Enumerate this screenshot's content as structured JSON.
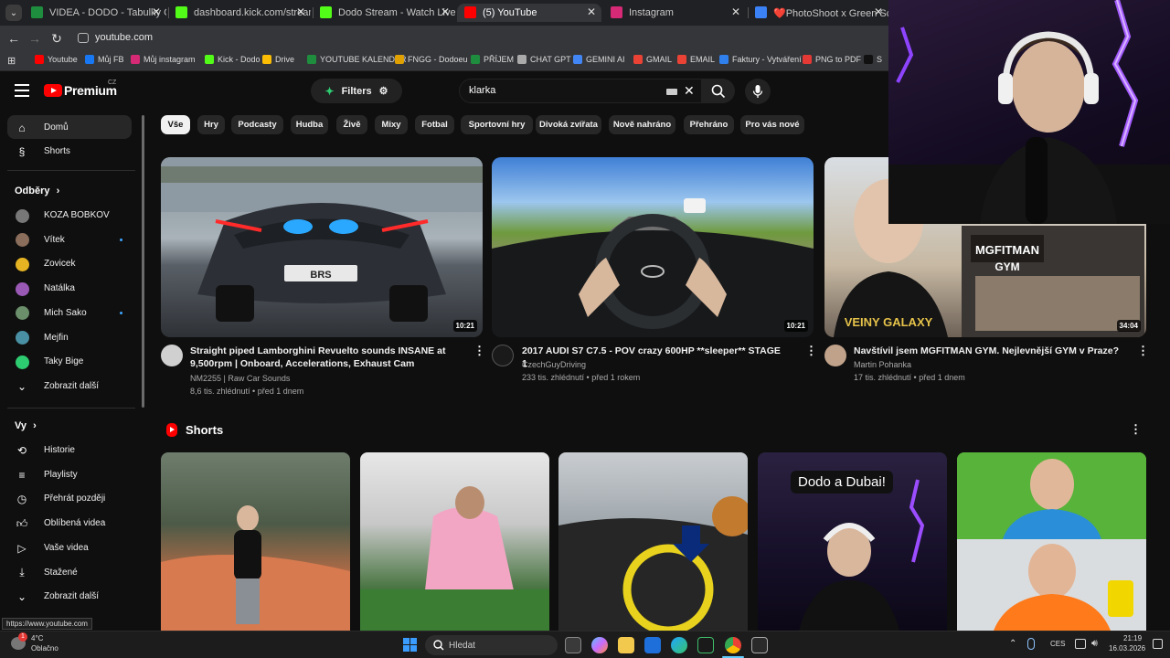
{
  "browser": {
    "tabs": [
      {
        "title": "VIDEA - DODO - Tabulky Googl",
        "favicon_color": "#1e8e3e"
      },
      {
        "title": "dashboard.kick.com/stream",
        "favicon_color": "#53fc18"
      },
      {
        "title": "Dodo Stream - Watch Live on K",
        "favicon_color": "#53fc18"
      },
      {
        "title": "(5) YouTube",
        "favicon_color": "#ff0000"
      },
      {
        "title": "Instagram",
        "favicon_color": "#d62976"
      },
      {
        "title": "❤️PhotoShoot x Green Scre",
        "favicon_color": "#3b82f6"
      }
    ],
    "active_tab_index": 3,
    "url": "youtube.com",
    "bookmarks": [
      {
        "label": "Youtube",
        "color": "#ff0000"
      },
      {
        "label": "Můj FB",
        "color": "#1877f2"
      },
      {
        "label": "Můj instagram",
        "color": "#d62976"
      },
      {
        "label": "Kick - Dodo",
        "color": "#53fc18"
      },
      {
        "label": "Drive",
        "color": "#fbbc04"
      },
      {
        "label": "YOUTUBE KALENDÁŘ",
        "color": "#1e8e3e"
      },
      {
        "label": "FNGG - Dodoeu",
        "color": "#e0a000"
      },
      {
        "label": "PŘÍJEM",
        "color": "#1e8e3e"
      },
      {
        "label": "CHAT GPT",
        "color": "#aaaaaa"
      },
      {
        "label": "GEMINI AI",
        "color": "#4285f4"
      },
      {
        "label": "GMAIL",
        "color": "#ea4335"
      },
      {
        "label": "EMAIL",
        "color": "#ea4335"
      },
      {
        "label": "Faktury - Vytváření",
        "color": "#2f80ed"
      },
      {
        "label": "PNG to PDF",
        "color": "#e53935"
      },
      {
        "label": "S",
        "color": "#111111"
      }
    ]
  },
  "youtube": {
    "brand": "Premium",
    "country": "CZ",
    "filters_label": "Filters",
    "search_value": "klarka",
    "sidebar": {
      "main": [
        {
          "label": "Domů",
          "icon": "home-icon"
        },
        {
          "label": "Shorts",
          "icon": "shorts-icon"
        }
      ],
      "subscriptions_title": "Odběry",
      "subscriptions": [
        {
          "label": "KOZA BOBKOV",
          "color": "#777777",
          "new": false
        },
        {
          "label": "Vítek",
          "color": "#8a6d5a",
          "new": true
        },
        {
          "label": "Zovicek",
          "color": "#e6b422",
          "new": false
        },
        {
          "label": "Natálka",
          "color": "#9b59b6",
          "new": false
        },
        {
          "label": "Mich Sako",
          "color": "#6b8e6b",
          "new": true
        },
        {
          "label": "Mejfin",
          "color": "#4a90a4",
          "new": false
        },
        {
          "label": "Taky Bige",
          "color": "#2ecc71",
          "new": false
        }
      ],
      "show_more": "Zobrazit další",
      "you_title": "Vy",
      "you": [
        {
          "label": "Historie",
          "icon": "history-icon"
        },
        {
          "label": "Playlisty",
          "icon": "playlist-icon"
        },
        {
          "label": "Přehrát později",
          "icon": "watch-later-icon"
        },
        {
          "label": "Oblíbená videa",
          "icon": "like-icon"
        },
        {
          "label": "Vaše videa",
          "icon": "your-videos-icon"
        },
        {
          "label": "Stažené",
          "icon": "download-icon"
        }
      ],
      "show_more_2": "Zobrazit další"
    },
    "chips": [
      "Vše",
      "Hry",
      "Podcasty",
      "Hudba",
      "Živě",
      "Mixy",
      "Fotbal",
      "Sportovní hry",
      "Divoká zvířata",
      "Nově nahráno",
      "Přehráno",
      "Pro vás nové"
    ],
    "videos": [
      {
        "title_line1": "Straight piped Lamborghini Revuelto sounds INSANE at",
        "title_line2": "9,500rpm | Onboard, Accelerations, Exhaust Cam",
        "channel": "NM2255 | Raw Car Sounds",
        "meta": "8,6 tis. zhlédnutí • před 1 dnem",
        "duration": "10:21"
      },
      {
        "title_line1": "2017 AUDI S7 C7.5 - POV crazy 600HP **sleeper** STAGE 1",
        "title_line2": "",
        "channel": "CzechGuyDriving",
        "meta": "233 tis. zhlédnutí • před 1 rokem",
        "duration": "10:21"
      },
      {
        "title_line1": "Navštívil jsem MGFITMAN GYM. Nejlevnější GYM v Praze?",
        "title_line2": "",
        "channel": "Martin Pohanka",
        "meta": "17 tis. zhlédnutí • před 1 dnem",
        "duration": "34:04",
        "thumb_text": "MGFITMAN GYM",
        "shirt_text": "VEINY GALAXY"
      }
    ],
    "shorts_title": "Shorts",
    "short_overlay_text": "Dodo a Dubai!"
  },
  "status_url": "https://www.youtube.com",
  "taskbar": {
    "weather_temp": "4°C",
    "weather_desc": "Oblačno",
    "weather_badge": "1",
    "search_placeholder": "Hledat",
    "language": "CES",
    "time": "21:19",
    "date": "16.03.2026"
  }
}
